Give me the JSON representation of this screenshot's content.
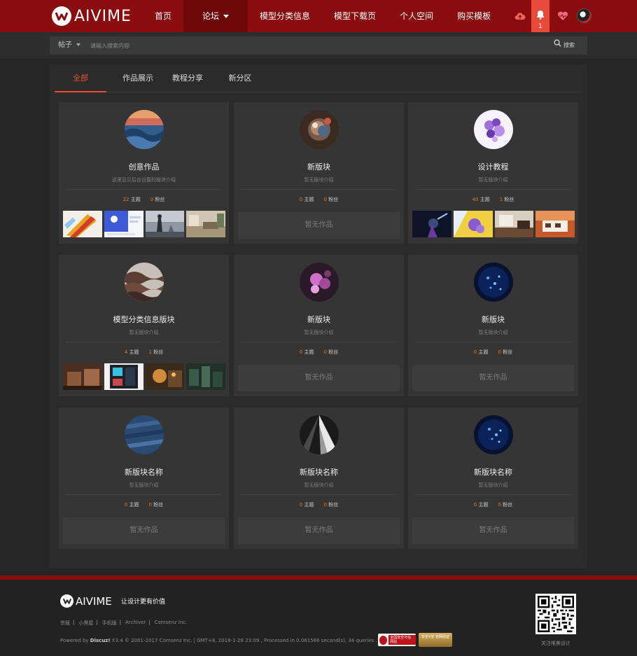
{
  "brand": {
    "name": "AIVIME",
    "accent": "#8a0c0e",
    "highlight": "#e8502f",
    "stat_color": "#e87a1e"
  },
  "nav": {
    "items": [
      {
        "label": "首页"
      },
      {
        "label": "论坛",
        "dropdown": true,
        "active": true
      },
      {
        "label": "模型分类信息"
      },
      {
        "label": "模型下载页"
      },
      {
        "label": "个人空间"
      },
      {
        "label": "购买模板"
      }
    ],
    "icons": [
      "cloud-upload-icon",
      "bell-icon",
      "heart-icon",
      "avatar"
    ],
    "notification_count": "1"
  },
  "search": {
    "type_label": "帖子",
    "placeholder": "请输入搜索内容",
    "button_label": "搜索"
  },
  "tabs": [
    {
      "label": "全部",
      "active": true
    },
    {
      "label": "作品展示"
    },
    {
      "label": "教程分享"
    },
    {
      "label": "新分区"
    }
  ],
  "labels": {
    "threads": "主题",
    "fans": "粉丝",
    "no_works": "暂无作品"
  },
  "cards": [
    {
      "title": "创意作品",
      "desc": "这里显示后台设置的版块介绍",
      "threads": "22",
      "fans": "0",
      "has_works": true
    },
    {
      "title": "新版块",
      "desc": "暂无版块介绍",
      "threads": "0",
      "fans": "0",
      "has_works": false
    },
    {
      "title": "设计教程",
      "desc": "暂无版块介绍",
      "threads": "40",
      "fans": "1",
      "has_works": true
    },
    {
      "title": "模型分类信息版块",
      "desc": "暂无版块介绍",
      "threads": "4",
      "fans": "1",
      "has_works": true
    },
    {
      "title": "新版块",
      "desc": "暂无版块介绍",
      "threads": "0",
      "fans": "0",
      "has_works": false
    },
    {
      "title": "新版块",
      "desc": "暂无版块介绍",
      "threads": "0",
      "fans": "0",
      "has_works": false
    },
    {
      "title": "新版块名称",
      "desc": "暂无版块介绍",
      "threads": "0",
      "fans": "0",
      "has_works": false
    },
    {
      "title": "新版块名称",
      "desc": "暂无版块介绍",
      "threads": "0",
      "fans": "0",
      "has_works": false
    },
    {
      "title": "新版块名称",
      "desc": "暂无版块介绍",
      "threads": "0",
      "fans": "0",
      "has_works": false
    }
  ],
  "footer": {
    "brand": "AIVIME",
    "slogan": "让设计更有价值",
    "links": [
      "举报",
      "小黑屋",
      "手机版",
      "Archiver",
      "Comsenz Inc."
    ],
    "powered_prefix": "Powered by ",
    "powered_name": "Discuz!",
    "powered_suffix": " X3.4  © 2001-2017 Comsenz Inc.  |  GMT+8, 2018-1-28 23:09 , Processed in 0.081566 second(s), 34 queries .",
    "badge1": "全国安全可信网站",
    "badge2": "安全V宝 官网验证",
    "qr_label": "关注唯美设计"
  }
}
